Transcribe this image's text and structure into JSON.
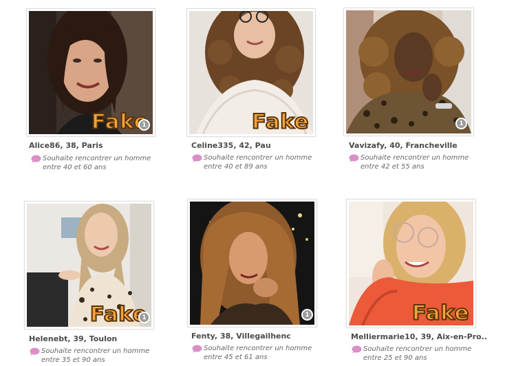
{
  "profiles": [
    {
      "name_line": "Alice86, 38, Paris",
      "wish_line1": "Souhaite rencontrer un homme",
      "wish_line2": "entre 40 et 60 ans",
      "stamp": "Fake",
      "photo_count": "1",
      "photo_label": "Alice86 profile photo"
    },
    {
      "name_line": "Celine335, 42, Pau",
      "wish_line1": "Souhaite rencontrer un homme",
      "wish_line2": "entre 40 et 89 ans",
      "stamp": "Fake",
      "photo_count": "",
      "photo_label": "Celine335 profile photo"
    },
    {
      "name_line": "Vavizafy, 40, Francheville",
      "wish_line1": "Souhaite rencontrer un homme",
      "wish_line2": "entre 42 et 55 ans",
      "stamp": "",
      "photo_count": "1",
      "photo_label": "Vavizafy profile photo"
    },
    {
      "name_line": "Helenebt, 39, Toulon",
      "wish_line1": "Souhaite rencontrer un homme",
      "wish_line2": "entre 35 et 90 ans",
      "stamp": "Fake",
      "photo_count": "1",
      "photo_label": "Helenebt profile photo"
    },
    {
      "name_line": "Fenty, 38, Villegailhenc",
      "wish_line1": "Souhaite rencontrer un homme",
      "wish_line2": "entre 45 et 61 ans",
      "stamp": "",
      "photo_count": "1",
      "photo_label": "Fenty profile photo"
    },
    {
      "name_line": "Melliermarie10, 39, Aix-en-Pro..",
      "wish_line1": "Souhaite rencontrer un homme",
      "wish_line2": "entre 25 et 90 ans",
      "stamp": "Fake",
      "photo_count": "",
      "photo_label": "Melliermarie10 profile photo"
    }
  ],
  "colors": {
    "stamp_fill": "#f5a33c",
    "stamp_outline": "#5a3305",
    "bubble_icon": "#d98fc7",
    "badge": "#9a9a9a"
  },
  "icons": {
    "wish_icon": "speech-bubble-icon"
  }
}
